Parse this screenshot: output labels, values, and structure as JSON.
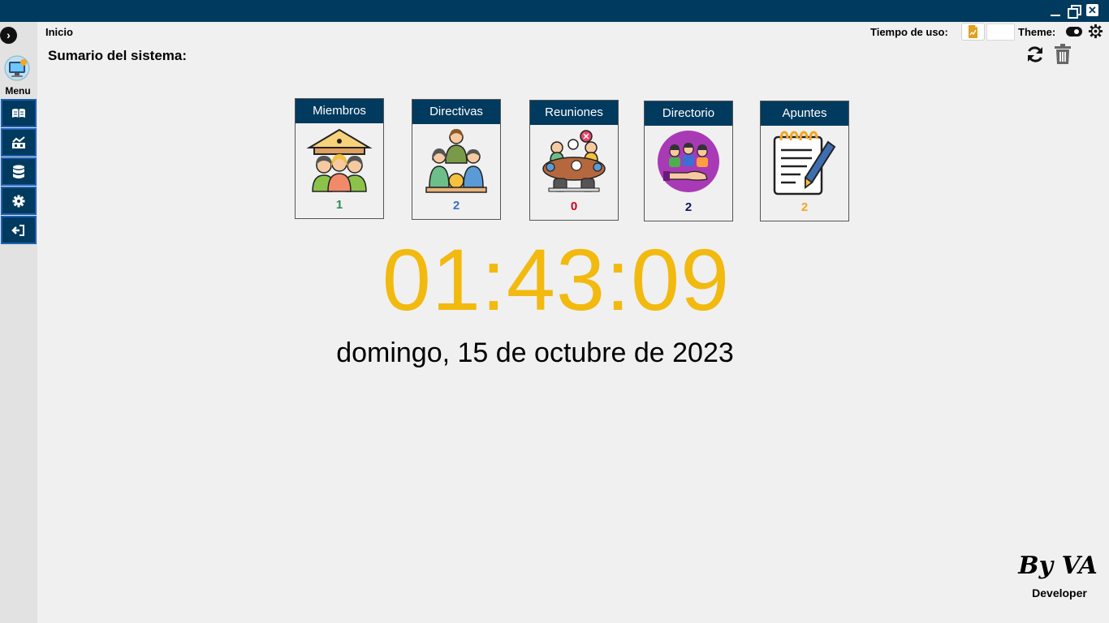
{
  "window": {
    "close_symbol": "✕"
  },
  "sidebar": {
    "toggle_symbol": "›",
    "menu_label": "Menu",
    "items": [
      {
        "icon": "book-open-icon"
      },
      {
        "icon": "chart-icon"
      },
      {
        "icon": "database-icon"
      },
      {
        "icon": "gear-icon"
      },
      {
        "icon": "sign-out-icon"
      }
    ]
  },
  "header": {
    "breadcrumb": "Inicio",
    "summary_title": "Sumario del sistema:",
    "usage_label": "Tiempo de uso:",
    "usage_value": "",
    "theme_label": "Theme:"
  },
  "cards": [
    {
      "title": "Miembros",
      "count": "1",
      "count_color": "#2e8b57",
      "icon": "members-building-icon"
    },
    {
      "title": "Directivas",
      "count": "2",
      "count_color": "#3a6fc4",
      "icon": "directives-team-icon"
    },
    {
      "title": "Reuniones",
      "count": "0",
      "count_color": "#d0021b",
      "icon": "meeting-table-icon"
    },
    {
      "title": "Directorio",
      "count": "2",
      "count_color": "#0d1a5c",
      "icon": "directory-people-icon"
    },
    {
      "title": "Apuntes",
      "count": "2",
      "count_color": "#f5a623",
      "icon": "notepad-pen-icon"
    }
  ],
  "clock": {
    "time": "01:43:09",
    "date": "domingo, 15 de octubre de 2023",
    "color": "#f2b90f"
  },
  "credits": {
    "signature": "By VA",
    "role": "Developer"
  },
  "colors": {
    "primary": "#003a5e",
    "background": "#f0f0f0",
    "sidebar": "#e2e2e2"
  }
}
